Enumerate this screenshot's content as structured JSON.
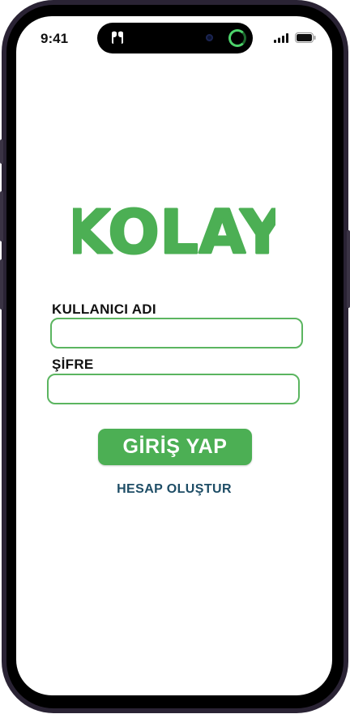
{
  "status_bar": {
    "time": "9:41",
    "icons": [
      "airpods-icon",
      "camera-dot",
      "activity-ring-icon",
      "signal-icon",
      "battery-icon"
    ]
  },
  "brand": {
    "logo_text": "KOLAY",
    "color": "#4caf54"
  },
  "login_form": {
    "username_label": "KULLANICI ADI",
    "username_value": "",
    "password_label": "ŞİFRE",
    "password_value": "",
    "submit_label": "GİRİŞ YAP",
    "create_account_label": "HESAP OLUŞTUR",
    "field_border_color": "#5bb560",
    "link_color": "#1e4d66"
  }
}
